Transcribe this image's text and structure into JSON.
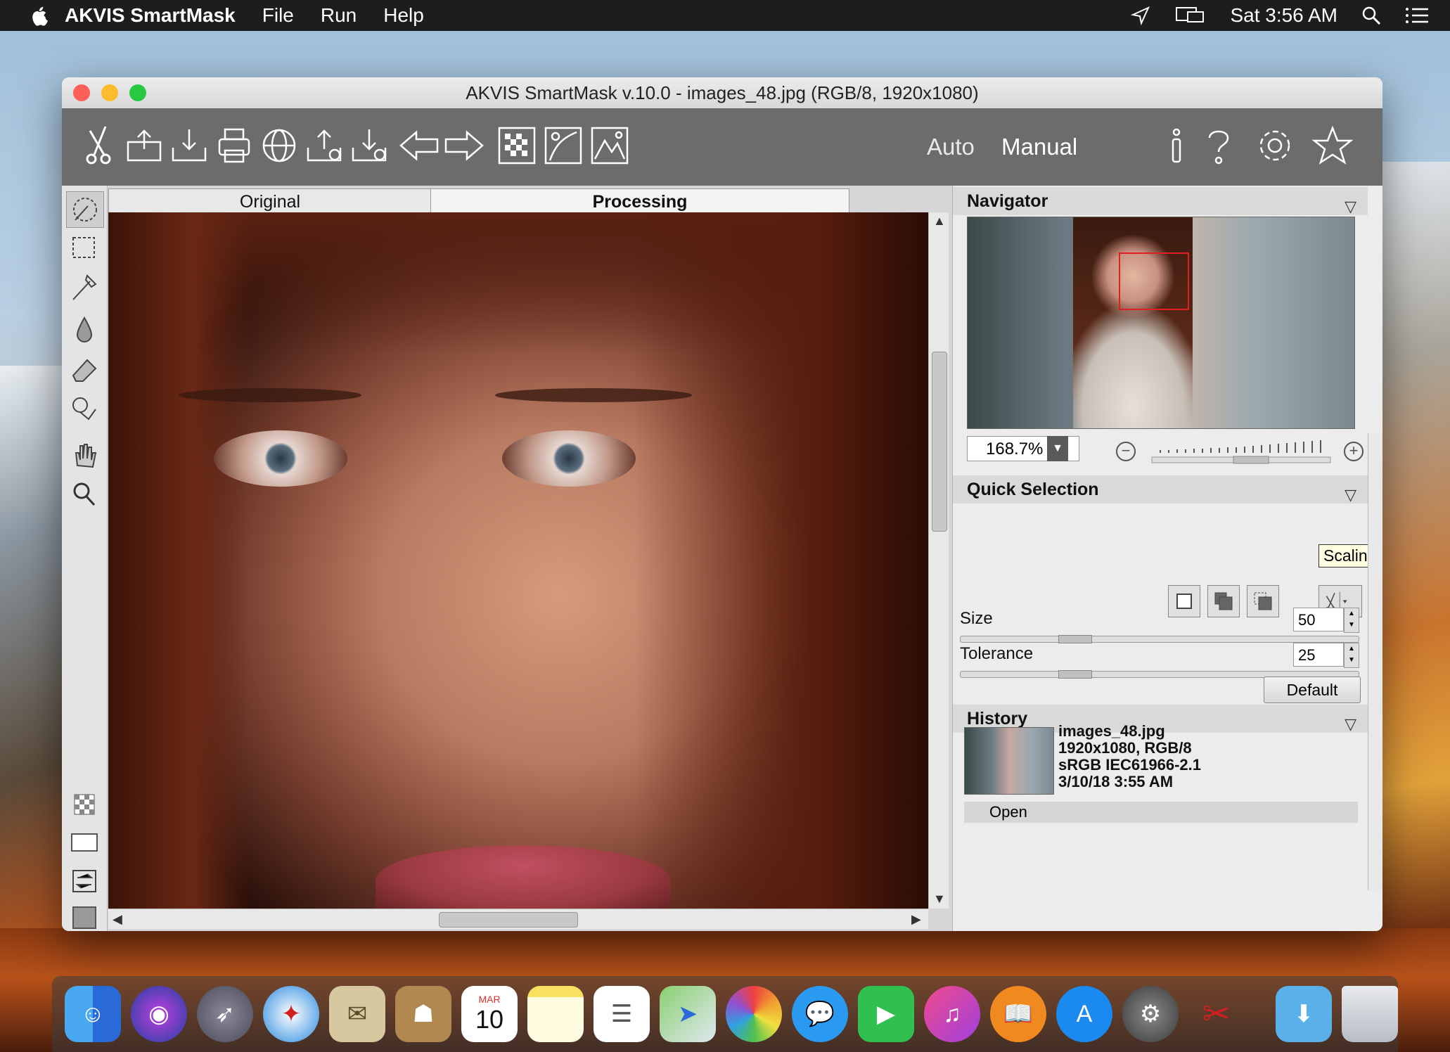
{
  "menubar": {
    "app_name": "AKVIS SmartMask",
    "menus": [
      "File",
      "Run",
      "Help"
    ],
    "clock": "Sat 3:56 AM"
  },
  "window": {
    "title": "AKVIS SmartMask v.10.0 - images_48.jpg (RGB/8, 1920x1080)"
  },
  "toolbar": {
    "icons": [
      "smartmask-logo-icon",
      "open-icon",
      "save-icon",
      "print-icon",
      "publish-icon",
      "share-icon",
      "batch-icon",
      "undo-icon",
      "redo-icon",
      "mask-icon",
      "background-icon",
      "image-icon",
      "info-icon",
      "help-icon",
      "settings-icon",
      "favorites-icon"
    ],
    "mode_auto": "Auto",
    "mode_manual": "Manual"
  },
  "tabs": {
    "original": "Original",
    "processing": "Processing"
  },
  "navigator": {
    "title": "Navigator",
    "zoom": "168.7%"
  },
  "quick_selection": {
    "title": "Quick Selection",
    "tooltip": "Scaling",
    "size_label": "Size",
    "size_value": "50",
    "size_fraction": 0.27,
    "tolerance_label": "Tolerance",
    "tolerance_value": "25",
    "tolerance_fraction": 0.27,
    "default_label": "Default"
  },
  "history": {
    "title": "History",
    "file": "images_48.jpg",
    "dims": "1920x1080, RGB/8",
    "profile": "sRGB IEC61966-2.1",
    "date": "3/10/18 3:55 AM",
    "open": "Open"
  },
  "dock": {
    "items": [
      "finder",
      "siri",
      "launchpad",
      "safari",
      "mail",
      "contacts",
      "calendar",
      "notes",
      "reminders",
      "maps",
      "photos",
      "messages",
      "facetime",
      "itunes",
      "ibooks",
      "app-store",
      "system-preferences",
      "smartmask",
      "downloads",
      "trash"
    ],
    "calendar_month": "MAR",
    "calendar_day": "10"
  }
}
